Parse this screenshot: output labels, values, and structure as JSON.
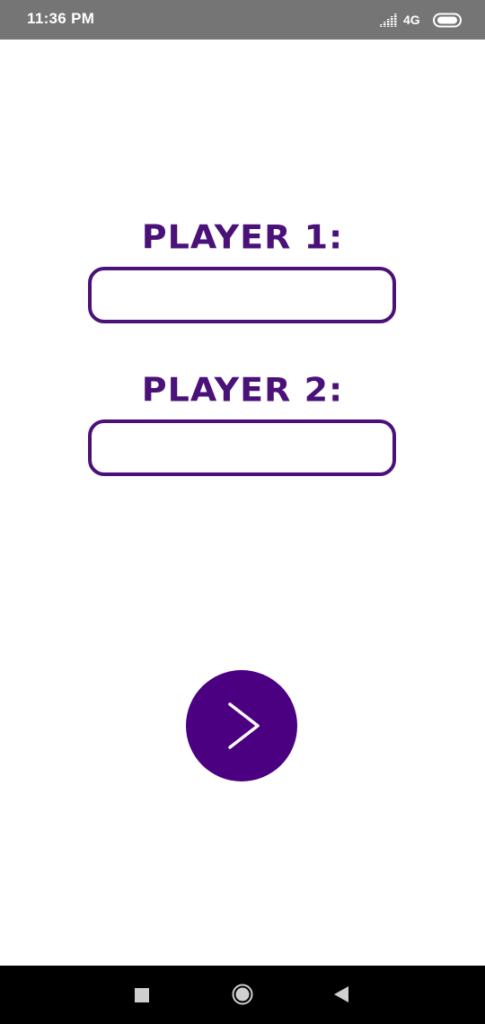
{
  "status_bar": {
    "time": "11:36 PM",
    "network": "4G",
    "signal_icon": "signal-bars-icon",
    "battery_icon": "battery-icon"
  },
  "form": {
    "player1_label": "PLAYER 1:",
    "player1_value": "",
    "player2_label": "PLAYER 2:",
    "player2_value": "",
    "next_icon": "chevron-right-icon"
  },
  "nav_bar": {
    "recents_icon": "square-recents-icon",
    "home_icon": "circle-home-icon",
    "back_icon": "triangle-back-icon"
  },
  "colors": {
    "accent": "#4a1178",
    "button": "#4b0082",
    "status_bar": "#757575",
    "nav_bar": "#000000",
    "background": "#ffffff"
  }
}
